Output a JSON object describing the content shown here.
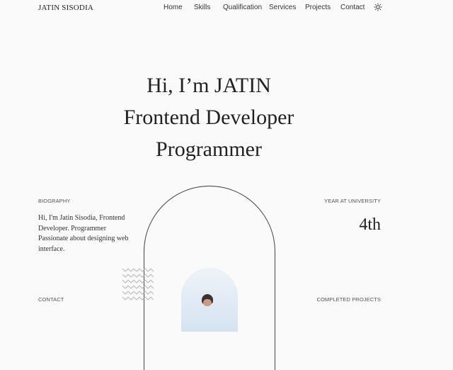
{
  "nav": {
    "logo": "JATIN SISODIA",
    "items": [
      "Home",
      "Skills",
      "Qualification",
      "Services",
      "Projects",
      "Contact"
    ],
    "theme_icon": "sun-icon"
  },
  "hero": {
    "line1": "Hi, I’m JATIN",
    "line2": "Frontend Developer",
    "line3": "Programmer"
  },
  "biography": {
    "label": "BIOGRAPHY",
    "text": "Hi, I'm Jatin Sisodia, Frontend Developer. Programmer Passionate about designing web interface."
  },
  "year": {
    "label": "YEAR AT UNIVERSITY",
    "value": "4th"
  },
  "contact": {
    "label": "CONTACT"
  },
  "projects": {
    "label": "COMPLETED PROJECTS"
  },
  "colors": {
    "background": "#fafafa",
    "text": "#1f1f1f",
    "photo_bg": "#dbe7f3"
  }
}
